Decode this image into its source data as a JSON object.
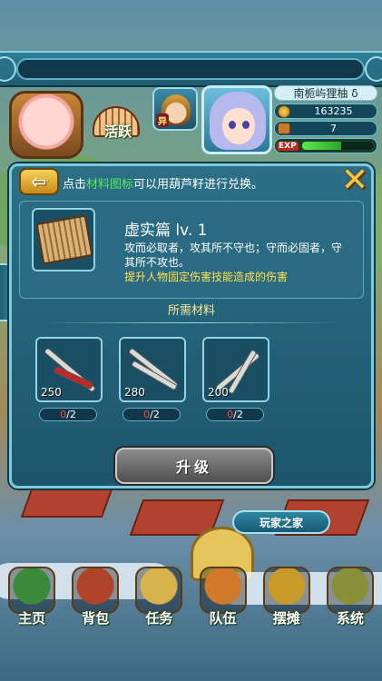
{
  "player": {
    "name": "南栀屿狸柚 δ",
    "gold": "163235",
    "bag": "7",
    "exp_label": "EXP",
    "exp_fraction": 0.55,
    "pet_tag": "异"
  },
  "activity": {
    "label": "活跃"
  },
  "dialog": {
    "hint_prefix": "点击",
    "hint_highlight": "材料图标",
    "hint_suffix": "可以用葫芦籽进行兑换。",
    "skill_name": "虚实篇 lv. 1",
    "skill_desc": "攻而必取者，攻其所不守也；守而必固者，守其所不攻也。",
    "skill_effect": "提升人物固定伤害技能造成的伤害",
    "required_title": "所需材料",
    "materials": [
      {
        "qty": "250",
        "have": "0",
        "need": "/2"
      },
      {
        "qty": "280",
        "have": "0",
        "need": "/2"
      },
      {
        "qty": "200",
        "have": "0",
        "need": "/2"
      }
    ],
    "upgrade_label": "升级",
    "close_glyph": "✕",
    "back_glyph": "⇦"
  },
  "home_label": "玩家之家",
  "nav": [
    {
      "label": "主页",
      "color": "#3a8a3a"
    },
    {
      "label": "背包",
      "color": "#b0442a"
    },
    {
      "label": "任务",
      "color": "#d8b24a"
    },
    {
      "label": "队伍",
      "color": "#d07a2a"
    },
    {
      "label": "摆摊",
      "color": "#c89a2a"
    },
    {
      "label": "系统",
      "color": "#8a8f3a"
    }
  ]
}
